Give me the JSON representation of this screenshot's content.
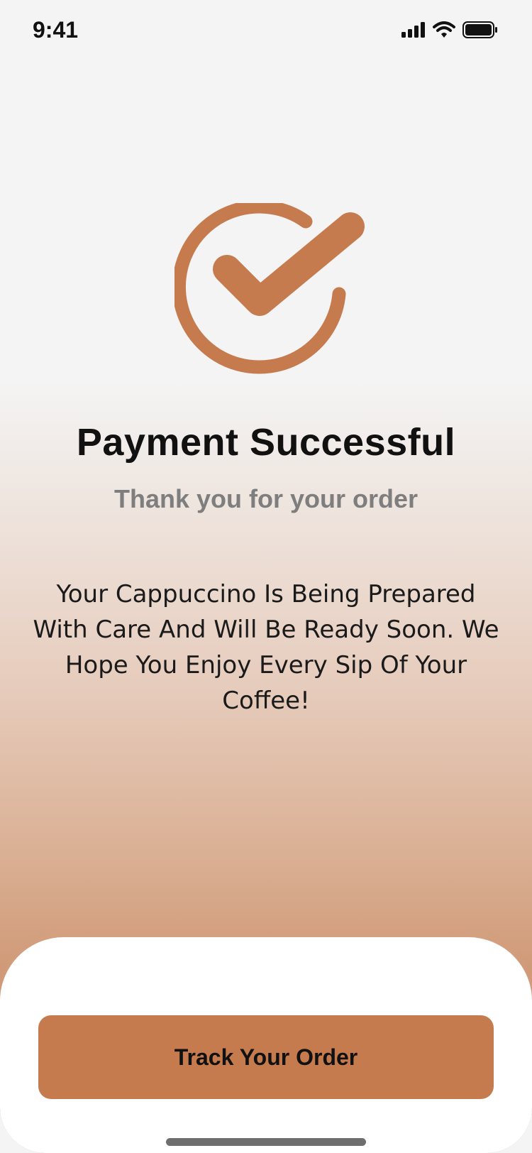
{
  "status_bar": {
    "time": "9:41"
  },
  "icons": {
    "signal": "cellular-signal-icon",
    "wifi": "wifi-icon",
    "battery": "battery-icon",
    "success": "check-circle-icon"
  },
  "colors": {
    "accent": "#c67b4f",
    "title": "#111111",
    "subtitle": "#7e7e7e"
  },
  "main": {
    "title": "Payment Successful",
    "subtitle": "Thank you for your order",
    "message": "Your Cappuccino Is Being Prepared With Care And Will Be Ready Soon. We Hope You Enjoy Every Sip Of Your Coffee!"
  },
  "footer": {
    "button_label": "Track Your Order"
  }
}
